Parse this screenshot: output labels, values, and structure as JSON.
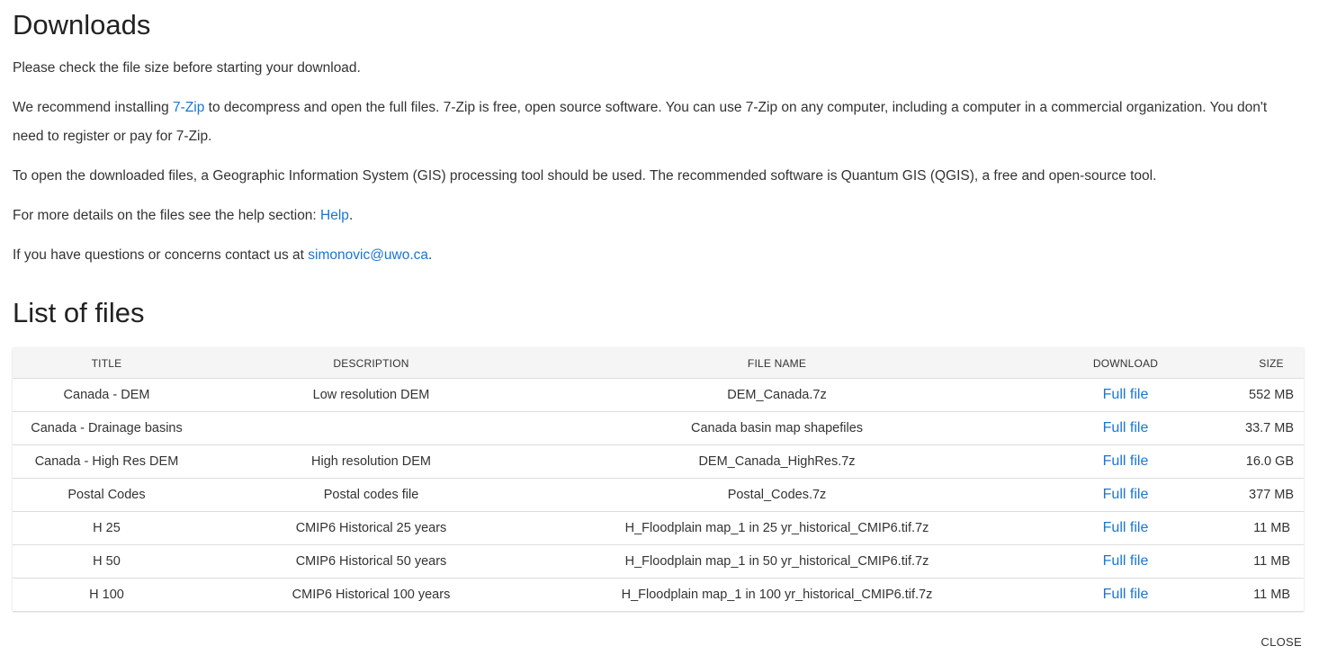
{
  "page": {
    "title": "Downloads",
    "list_title": "List of files",
    "close_label": "CLOSE"
  },
  "paragraphs": {
    "p1": "Please check the file size before starting your download.",
    "p2_pre": "We recommend installing ",
    "p2_link": "7-Zip",
    "p2_post": " to decompress and open the full files. 7-Zip is free, open source software. You can use 7-Zip on any computer, including a computer in a commercial organization. You don't need to register or pay for 7-Zip.",
    "p3": "To open the downloaded files, a Geographic Information System (GIS) processing tool should be used. The recommended software is Quantum GIS (QGIS), a free and open-source tool.",
    "p4_pre": "For more details on the files see the help section: ",
    "p4_link": "Help",
    "p4_post": ".",
    "p5_pre": "If you have questions or concerns contact us at ",
    "p5_link": "simonovic@uwo.ca",
    "p5_post": "."
  },
  "table": {
    "headers": {
      "title": "TITLE",
      "description": "DESCRIPTION",
      "file_name": "FILE NAME",
      "download": "DOWNLOAD",
      "size": "SIZE"
    },
    "rows": [
      {
        "title": "Canada - DEM",
        "description": "Low resolution DEM",
        "file_name": "DEM_Canada.7z",
        "download": "Full file",
        "size": "552 MB"
      },
      {
        "title": "Canada - Drainage basins",
        "description": "",
        "file_name": "Canada basin map shapefiles",
        "download": "Full file",
        "size": "33.7 MB"
      },
      {
        "title": "Canada - High Res DEM",
        "description": "High resolution DEM",
        "file_name": "DEM_Canada_HighRes.7z",
        "download": "Full file",
        "size": "16.0 GB"
      },
      {
        "title": "Postal Codes",
        "description": "Postal codes file",
        "file_name": "Postal_Codes.7z",
        "download": "Full file",
        "size": "377 MB"
      },
      {
        "title": "H 25",
        "description": "CMIP6 Historical 25 years",
        "file_name": "H_Floodplain map_1 in 25 yr_historical_CMIP6.tif.7z",
        "download": "Full file",
        "size": "11 MB"
      },
      {
        "title": "H 50",
        "description": "CMIP6 Historical 50 years",
        "file_name": "H_Floodplain map_1 in 50 yr_historical_CMIP6.tif.7z",
        "download": "Full file",
        "size": "11 MB"
      },
      {
        "title": "H 100",
        "description": "CMIP6 Historical 100 years",
        "file_name": "H_Floodplain map_1 in 100 yr_historical_CMIP6.tif.7z",
        "download": "Full file",
        "size": "11 MB"
      }
    ]
  },
  "colors": {
    "link": "#1976d2",
    "text": "#333333",
    "header_bg": "#f5f5f5",
    "border": "#dddddd"
  }
}
